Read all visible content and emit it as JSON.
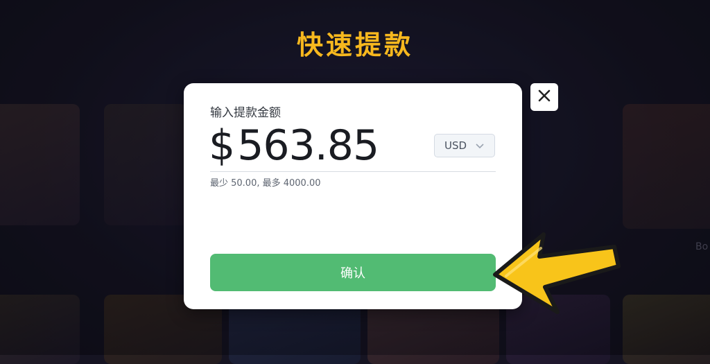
{
  "page": {
    "title": "快速提款"
  },
  "background": {
    "side_labels": [
      "Bo"
    ]
  },
  "withdraw_dialog": {
    "label": "输入提款金额",
    "currency_symbol": "$",
    "amount": "563.85",
    "currency": "USD",
    "limits": "最少 50.00, 最多 4000.00",
    "confirm_label": "确认"
  },
  "icons": {
    "close": "close-icon",
    "chevron": "chevron-down-icon",
    "arrow": "pointer-arrow-icon"
  },
  "colors": {
    "title": "#f7b81e",
    "confirm": "#52bb73",
    "arrow_fill": "#f8c41a"
  }
}
